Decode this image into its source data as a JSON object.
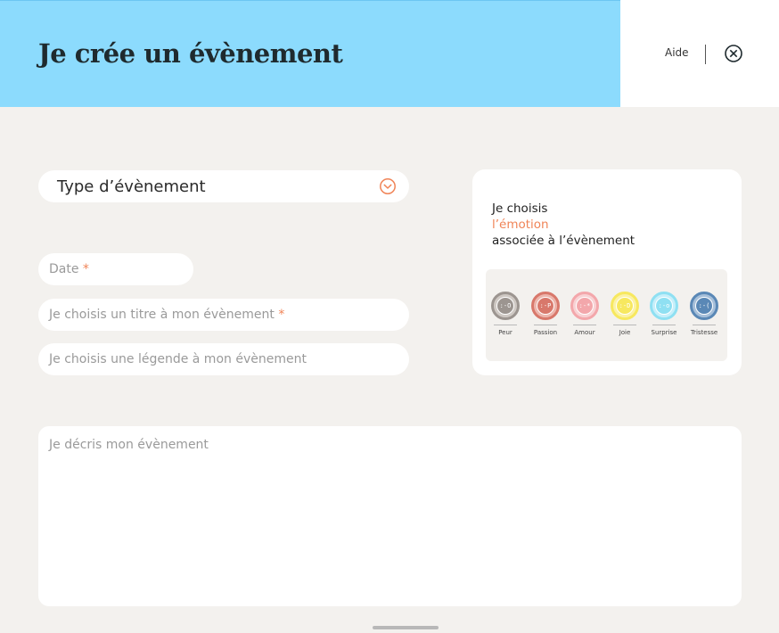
{
  "header": {
    "title": "Je crée un évènement",
    "help_label": "Aide",
    "close_icon": "close-circle-icon",
    "colors": {
      "banner": "#8cdbfd",
      "accent": "#f08457"
    }
  },
  "form": {
    "event_type": {
      "label": "Type d’évènement",
      "icon": "chevron-down-icon"
    },
    "date": {
      "placeholder": "Date",
      "required_mark": "*"
    },
    "title": {
      "placeholder": "Je choisis un titre à mon évènement",
      "required_mark": "*"
    },
    "caption": {
      "placeholder": "Je choisis une légende à mon évènement"
    },
    "description": {
      "placeholder": "Je décris mon évènement"
    }
  },
  "emotion": {
    "heading_line1": "Je choisis",
    "heading_line2": "l’émotion",
    "heading_line3": "associée à l’évènement",
    "options": [
      {
        "label": "Peur",
        "face": ":-O",
        "color": "#9c9590",
        "ring": "#cfc9c4"
      },
      {
        "label": "Passion",
        "face": ":-P",
        "color": "#d8786b",
        "ring": "#edb6ad"
      },
      {
        "label": "Amour",
        "face": ":-*",
        "color": "#f3a7ab",
        "ring": "#f8d2d4"
      },
      {
        "label": "Joie",
        "face": ":-D",
        "color": "#f7e85f",
        "ring": "#fbf2a6"
      },
      {
        "label": "Surprise",
        "face": ":-o",
        "color": "#8fe0f2",
        "ring": "#c7effa"
      },
      {
        "label": "Tristesse",
        "face": ":-(",
        "color": "#5a88b6",
        "ring": "#a7c0da"
      }
    ]
  }
}
